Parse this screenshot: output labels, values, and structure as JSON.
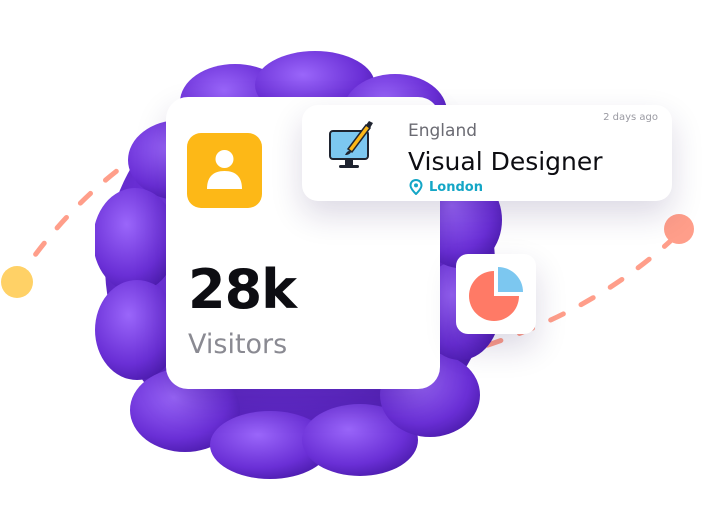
{
  "stats": {
    "value": "28k",
    "label": "Visitors"
  },
  "job": {
    "region": "England",
    "posted": "2 days ago",
    "title": "Visual Designer",
    "location": "London"
  },
  "icons": {
    "avatar": "user-icon",
    "monitor": "monitor-brush-icon",
    "pin": "location-pin-icon",
    "pie": "pie-chart-icon"
  },
  "colors": {
    "blob": "#6A2FD6",
    "avatar_tile": "#FDB817",
    "location_text": "#14A6C6",
    "pie_main": "#FF7A66",
    "pie_slice": "#7CC7F0",
    "dot_left": "#FFD166",
    "dot_right": "#FF9E8A"
  }
}
